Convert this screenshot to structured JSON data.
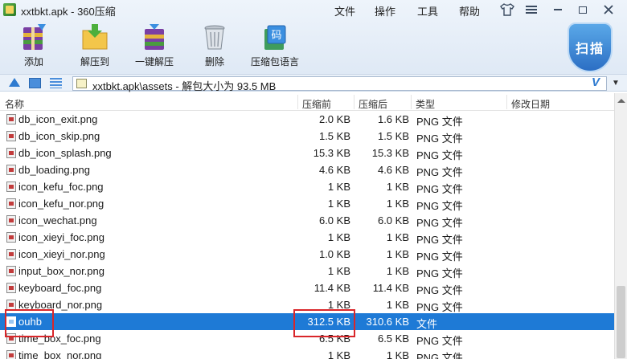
{
  "window": {
    "title": "xxtbkt.apk - 360压缩"
  },
  "menu": {
    "file": "文件",
    "operate": "操作",
    "tools": "工具",
    "help": "帮助"
  },
  "toolbar": {
    "add": "添加",
    "extract_to": "解压到",
    "one_click_extract": "一键解压",
    "delete": "删除",
    "archive_language": "压缩包语言",
    "scan": "扫描",
    "lang_icon_text": "码"
  },
  "address": {
    "path": "xxtbkt.apk\\assets - 解包大小为 93.5 MB",
    "logo": "V"
  },
  "columns": {
    "name": "名称",
    "packed": "压缩前",
    "unpacked": "压缩后",
    "type": "类型",
    "modified": "修改日期"
  },
  "rows": [
    {
      "name": "db_icon_exit.png",
      "packed": "2.0 KB",
      "unpacked": "1.6 KB",
      "type": "PNG 文件"
    },
    {
      "name": "db_icon_skip.png",
      "packed": "1.5 KB",
      "unpacked": "1.5 KB",
      "type": "PNG 文件"
    },
    {
      "name": "db_icon_splash.png",
      "packed": "15.3 KB",
      "unpacked": "15.3 KB",
      "type": "PNG 文件"
    },
    {
      "name": "db_loading.png",
      "packed": "4.6 KB",
      "unpacked": "4.6 KB",
      "type": "PNG 文件"
    },
    {
      "name": "icon_kefu_foc.png",
      "packed": "1 KB",
      "unpacked": "1 KB",
      "type": "PNG 文件"
    },
    {
      "name": "icon_kefu_nor.png",
      "packed": "1 KB",
      "unpacked": "1 KB",
      "type": "PNG 文件"
    },
    {
      "name": "icon_wechat.png",
      "packed": "6.0 KB",
      "unpacked": "6.0 KB",
      "type": "PNG 文件"
    },
    {
      "name": "icon_xieyi_foc.png",
      "packed": "1 KB",
      "unpacked": "1 KB",
      "type": "PNG 文件"
    },
    {
      "name": "icon_xieyi_nor.png",
      "packed": "1.0 KB",
      "unpacked": "1 KB",
      "type": "PNG 文件"
    },
    {
      "name": "input_box_nor.png",
      "packed": "1 KB",
      "unpacked": "1 KB",
      "type": "PNG 文件"
    },
    {
      "name": "keyboard_foc.png",
      "packed": "11.4 KB",
      "unpacked": "11.4 KB",
      "type": "PNG 文件"
    },
    {
      "name": "keyboard_nor.png",
      "packed": "1 KB",
      "unpacked": "1 KB",
      "type": "PNG 文件"
    },
    {
      "name": "ouhb",
      "packed": "312.5 KB",
      "unpacked": "310.6 KB",
      "type": "文件"
    },
    {
      "name": "time_box_foc.png",
      "packed": "6.5 KB",
      "unpacked": "6.5 KB",
      "type": "PNG 文件"
    },
    {
      "name": "time_box_nor.png",
      "packed": "1 KB",
      "unpacked": "1 KB",
      "type": "PNG 文件"
    }
  ],
  "selected_row": 12,
  "colors": {
    "selection": "#1e7ad6",
    "highlight": "#d9262a"
  }
}
